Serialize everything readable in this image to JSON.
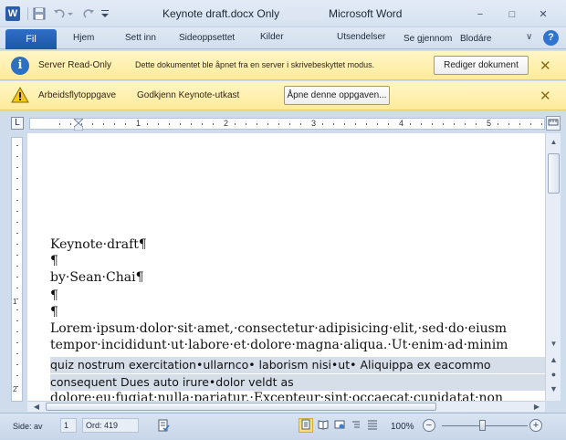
{
  "window": {
    "document_title": "Keynote draft.docx Only -",
    "app_title": "Microsoft Word",
    "word_icon": "W",
    "minimize": "−",
    "maximize": "□",
    "close": "✕"
  },
  "quick_access": {
    "save_icon": "save-icon",
    "undo_icon": "undo-icon",
    "redo_icon": "redo-icon",
    "customize_icon": "customize-qat-icon"
  },
  "ribbon": {
    "file_tab": "Fil",
    "tabs": [
      "Hjem",
      "Sett inn",
      "Sideoppsettet",
      "Kilder",
      "Utsendelser",
      "Se gjennom",
      "Blodáre"
    ],
    "help": "?",
    "minimize_ribbon": "∨"
  },
  "message_bars": [
    {
      "label": "Server Read-Only",
      "text": "Dette dokumentet ble åpnet fra en server i skrivebeskyttet modus.",
      "button": "Rediger dokument",
      "close": "✕"
    },
    {
      "label": "Arbeidsflytoppgave",
      "text": "Godkjenn Keynote-utkast",
      "button": "Åpne denne oppgaven...",
      "close": "✕"
    }
  ],
  "ruler": {
    "corner": "L",
    "numbers": [
      "1",
      "2",
      "3",
      "4",
      "5"
    ]
  },
  "vertical_ruler": {
    "numbers": [
      "1",
      "2"
    ]
  },
  "document": {
    "lines": [
      "Keynote·draft¶",
      "¶",
      "by·Sean·Chai¶",
      "¶",
      "¶",
      "Lorem·ipsum·dolor·sit·amet,·consectetur·adipisicing·elit,·sed·do·eiusm",
      "tempor·incididunt·ut·labore·et·dolore·magna·aliqua.·Ut·enim·ad·minim"
    ],
    "selected_lines": [
      "quiz nostrum exercitation•ullarnco• laborism nisi•ut• Aliquippa ex eacommo",
      "consequent Dues auto irure•dolor veldt as"
    ],
    "cutoff_line": "dolore·eu·fugiat·nulla·pariatur.·Excepteur·sint·occaecat·cupidatat·non"
  },
  "status_bar": {
    "page_label": "Side: av",
    "page_value": "1",
    "words_label": "Ord: 419",
    "zoom": "100%",
    "zoom_minus": "−",
    "zoom_plus": "+"
  },
  "colors": {
    "file_tab": "#1d56a6",
    "message_bar": "#fdeb9a",
    "selection": "#d6dee9"
  }
}
